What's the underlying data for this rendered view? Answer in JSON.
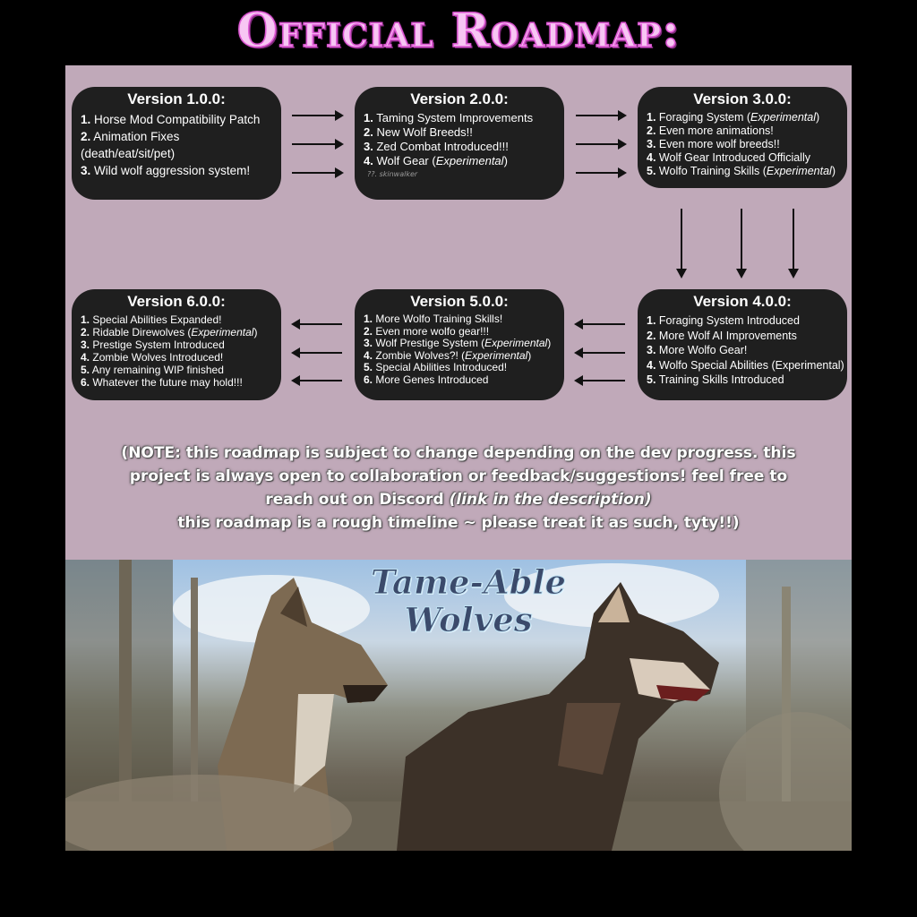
{
  "title": "Official Roadmap:",
  "versions": [
    {
      "label": "Version 1.0.0:",
      "items": [
        {
          "num": "1.",
          "text": "Horse Mod Compatibility Patch",
          "exp": ""
        },
        {
          "num": "2.",
          "text": "Animation Fixes",
          "exp": ""
        },
        {
          "num": "",
          "text": "(death/eat/sit/pet)",
          "exp": ""
        },
        {
          "num": "3.",
          "text": "Wild wolf aggression system!",
          "exp": ""
        }
      ]
    },
    {
      "label": "Version 2.0.0:",
      "items": [
        {
          "num": "1.",
          "text": "Taming System Improvements",
          "exp": ""
        },
        {
          "num": "2.",
          "text": "New Wolf Breeds!!",
          "exp": ""
        },
        {
          "num": "3.",
          "text": "Zed Combat Introduced!!!",
          "exp": ""
        },
        {
          "num": "4.",
          "text": "Wolf Gear (",
          "exp": "Experimental",
          "close": ")"
        }
      ],
      "footnote": "??. skinwalker"
    },
    {
      "label": "Version 3.0.0:",
      "items": [
        {
          "num": "1.",
          "text": "Foraging System (",
          "exp": "Experimental",
          "close": ")"
        },
        {
          "num": "2.",
          "text": "Even more animations!",
          "exp": ""
        },
        {
          "num": "3.",
          "text": "Even more wolf breeds!!",
          "exp": ""
        },
        {
          "num": "4.",
          "text": "Wolf Gear Introduced Officially",
          "exp": ""
        },
        {
          "num": "5.",
          "text": "Wolfo Training Skills (",
          "exp": "Experimental",
          "close": ")"
        }
      ]
    },
    {
      "label": "Version 4.0.0:",
      "items": [
        {
          "num": "1.",
          "text": "Foraging System Introduced",
          "exp": ""
        },
        {
          "num": "2.",
          "text": "More Wolf AI Improvements",
          "exp": ""
        },
        {
          "num": "3.",
          "text": "More Wolfo Gear!",
          "exp": ""
        },
        {
          "num": "4.",
          "text": "Wolfo Special Abilities (Experimental)",
          "exp": ""
        },
        {
          "num": "5.",
          "text": "Training Skills Introduced",
          "exp": ""
        }
      ]
    },
    {
      "label": "Version 5.0.0:",
      "items": [
        {
          "num": "1.",
          "text": "More Wolfo Training Skills!",
          "exp": ""
        },
        {
          "num": "2.",
          "text": "Even more wolfo gear!!!",
          "exp": ""
        },
        {
          "num": "3.",
          "text": "Wolf Prestige System (",
          "exp": "Experimental",
          "close": ")"
        },
        {
          "num": "4.",
          "text": "Zombie Wolves?! (",
          "exp": "Experimental",
          "close": ")"
        },
        {
          "num": "5.",
          "text": "Special Abilities Introduced!",
          "exp": ""
        },
        {
          "num": "6.",
          "text": "More Genes Introduced",
          "exp": ""
        }
      ]
    },
    {
      "label": "Version 6.0.0:",
      "items": [
        {
          "num": "1.",
          "text": "Special Abilities Expanded!",
          "exp": ""
        },
        {
          "num": "2.",
          "text": "Ridable Direwolves (",
          "exp": "Experimental",
          "close": ")"
        },
        {
          "num": "3.",
          "text": "Prestige System Introduced",
          "exp": ""
        },
        {
          "num": "4.",
          "text": "Zombie Wolves Introduced!",
          "exp": ""
        },
        {
          "num": "5.",
          "text": "Any remaining WIP finished",
          "exp": ""
        },
        {
          "num": "6.",
          "text": "Whatever the future may hold!!!",
          "exp": ""
        }
      ]
    }
  ],
  "note": {
    "line1": "(NOTE:  this roadmap is subject to change depending on the dev progress. this",
    "line2": "project is always open to collaboration or feedback/suggestions! feel free to",
    "line3_a": "reach out on Discord ",
    "line3_b": "(link in the description)",
    "line4": "this roadmap is a rough timeline  ~ please treat it as such, tyty!!)"
  },
  "banner": {
    "title_line1": "Tame-Able",
    "title_line2": "Wolves"
  },
  "colors": {
    "panel": "#c0a9b9",
    "box": "#1f1f1f",
    "title_fill": "#f7c6f3",
    "title_stroke": "#e05ad6"
  }
}
